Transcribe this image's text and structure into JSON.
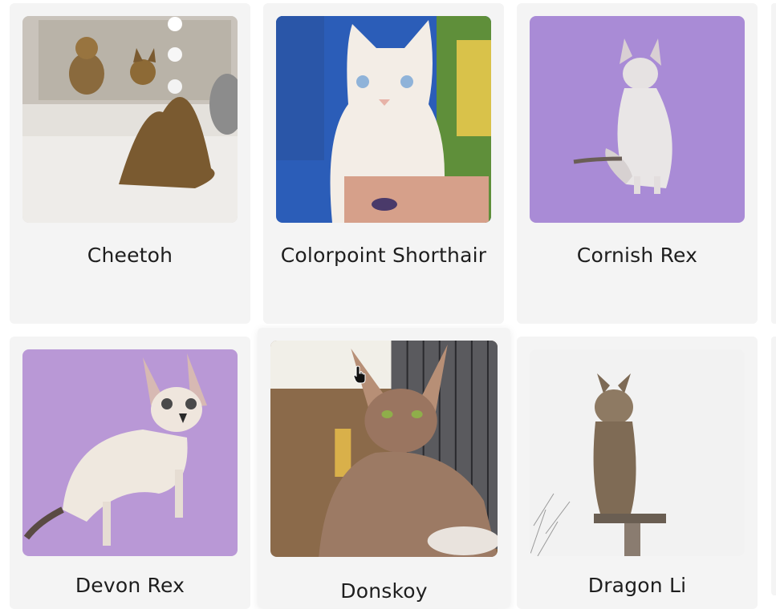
{
  "breeds": [
    {
      "name": "Cheetoh",
      "image_alt": "Bengal-type cat beside a vanity mirror"
    },
    {
      "name": "Colorpoint Shorthair",
      "image_alt": "Cream colorpoint cat held by a person"
    },
    {
      "name": "Cornish Rex",
      "image_alt": "Curly-coated white cat on purple background"
    },
    {
      "name": "Devon Rex",
      "image_alt": "Pale Devon Rex cat on lilac background"
    },
    {
      "name": "Donskoy",
      "image_alt": "Hairless Donskoy cat indoors"
    },
    {
      "name": "Dragon Li",
      "image_alt": "Tabby cat sitting on a post"
    }
  ],
  "colors": {
    "card_bg": "#f4f4f4",
    "text": "#1e1e1e",
    "purple_bg": "#a98bd6",
    "lilac_bg": "#b998d6"
  }
}
